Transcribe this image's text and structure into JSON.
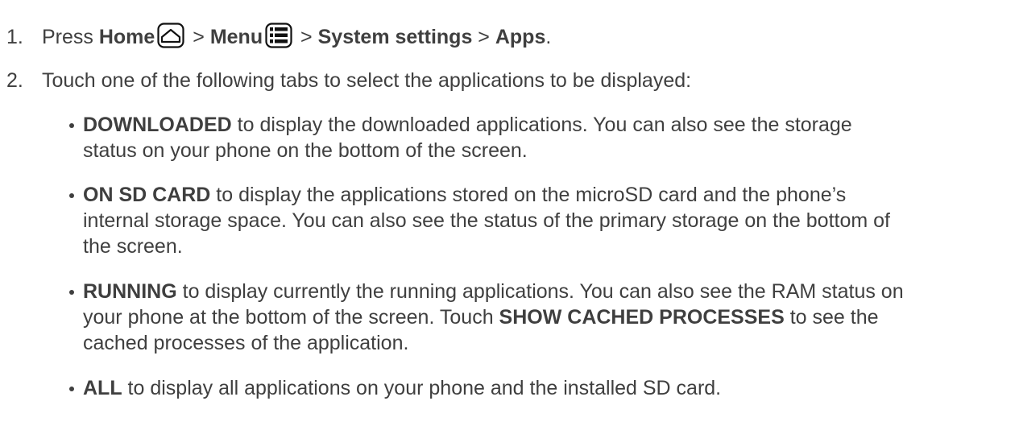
{
  "step1": {
    "num": "1.",
    "t1": "Press ",
    "home": "Home",
    "sep1": " > ",
    "menu": "Menu",
    "sep2": " > ",
    "system": "System settings",
    "sep3": " > ",
    "apps": "Apps",
    "end": ".",
    "icons": [
      "home-icon",
      "menu-icon"
    ]
  },
  "step2": {
    "num": "2.",
    "text": "Touch one of the following tabs to select the applications to be displayed:"
  },
  "bullets": [
    {
      "label": "DOWNLOADED",
      "lines": [
        " to display the downloaded applications. You can also see the storage",
        "status on your phone on the bottom of the screen."
      ]
    },
    {
      "label": "ON SD CARD",
      "lines": [
        " to display the applications stored on the microSD card and the phone’s",
        "internal storage space. You can also see the status of the primary storage on the bottom of",
        "the screen."
      ]
    },
    {
      "label": "RUNNING",
      "line1": " to display currently the running applications. You can also see the RAM status on",
      "line2a": "your phone at the bottom of the screen. Touch ",
      "cached": "SHOW CACHED PROCESSES",
      "line2b": " to see the",
      "line3": "cached processes of the application."
    },
    {
      "label": "ALL",
      "lines": [
        " to display all applications on your phone and the installed SD card."
      ]
    }
  ]
}
